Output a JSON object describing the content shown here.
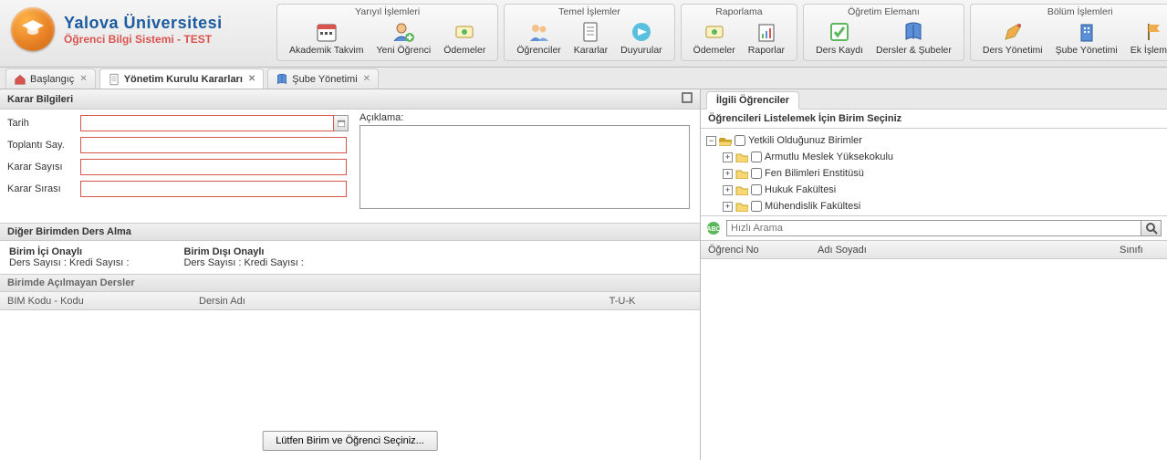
{
  "logo": {
    "line1": "Yalova Üniversitesi",
    "line2": "Öğrenci Bilgi Sistemi - TEST"
  },
  "ribbon_more": "»",
  "ribbon": [
    {
      "title": "Yarıyıl İşlemleri",
      "items": [
        {
          "key": "akademik-takvim",
          "label": "Akademik Takvim"
        },
        {
          "key": "yeni-ogrenci",
          "label": "Yeni Öğrenci"
        },
        {
          "key": "odemeler1",
          "label": "Ödemeler"
        }
      ]
    },
    {
      "title": "Temel İşlemler",
      "items": [
        {
          "key": "ogrenciler",
          "label": "Öğrenciler"
        },
        {
          "key": "kararlar",
          "label": "Kararlar"
        },
        {
          "key": "duyurular",
          "label": "Duyurular"
        }
      ]
    },
    {
      "title": "Raporlama",
      "items": [
        {
          "key": "odemeler2",
          "label": "Ödemeler"
        },
        {
          "key": "raporlar",
          "label": "Raporlar"
        }
      ]
    },
    {
      "title": "Öğretim Elemanı",
      "items": [
        {
          "key": "ders-kaydi",
          "label": "Ders Kaydı"
        },
        {
          "key": "dersler-subeler",
          "label": "Dersler & Şubeler"
        }
      ]
    },
    {
      "title": "Bölüm İşlemleri",
      "items": [
        {
          "key": "ders-yonetimi",
          "label": "Ders Yönetimi"
        },
        {
          "key": "sube-yonetimi",
          "label": "Şube Yönetimi"
        },
        {
          "key": "ek-islemler",
          "label": "Ek İşlemler"
        }
      ]
    }
  ],
  "tabs": [
    {
      "key": "baslangic",
      "label": "Başlangıç",
      "active": false
    },
    {
      "key": "yonetim-kurulu",
      "label": "Yönetim Kurulu Kararları",
      "active": true
    },
    {
      "key": "sube-yonetimi",
      "label": "Şube Yönetimi",
      "active": false
    }
  ],
  "left": {
    "panel_title": "Karar Bilgileri",
    "form": {
      "tarih_label": "Tarih",
      "tarih_value": "",
      "toplanti_label": "Toplantı Say.",
      "toplanti_value": "",
      "karar_sayisi_label": "Karar Sayısı",
      "karar_sayisi_value": "",
      "karar_sirasi_label": "Karar Sırası",
      "karar_sirasi_value": "",
      "aciklama_label": "Açıklama:",
      "aciklama_value": ""
    },
    "section2_title": "Diğer Birimden Ders Alma",
    "onay": {
      "ici_title": "Birim İçi Onaylı",
      "ici_line": "Ders Sayısı : Kredi Sayısı :",
      "disi_title": "Birim Dışı Onaylı",
      "disi_line": "Ders Sayısı : Kredi Sayısı :"
    },
    "section3_title": "Birimde Açılmayan Dersler",
    "grid_cols": {
      "c1": "BIM Kodu - Kodu",
      "c2": "Dersin Adı",
      "c3": "T-U-K"
    },
    "center_button": "Lütfen Birim ve Öğrenci Seçiniz..."
  },
  "right": {
    "tab_label": "İlgili Öğrenciler",
    "tree_title": "Öğrencileri Listelemek İçin Birim Seçiniz",
    "tree": {
      "root": "Yetkili Olduğunuz Birimler",
      "children": [
        "Armutlu Meslek Yüksekokulu",
        "Fen Bilimleri Enstitüsü",
        "Hukuk Fakültesi",
        "Mühendislik Fakültesi"
      ]
    },
    "search_placeholder": "Hızlı Arama",
    "stud_cols": {
      "c1": "Öğrenci No",
      "c2": "Adı Soyadı",
      "c3": "Sınıfı"
    }
  }
}
